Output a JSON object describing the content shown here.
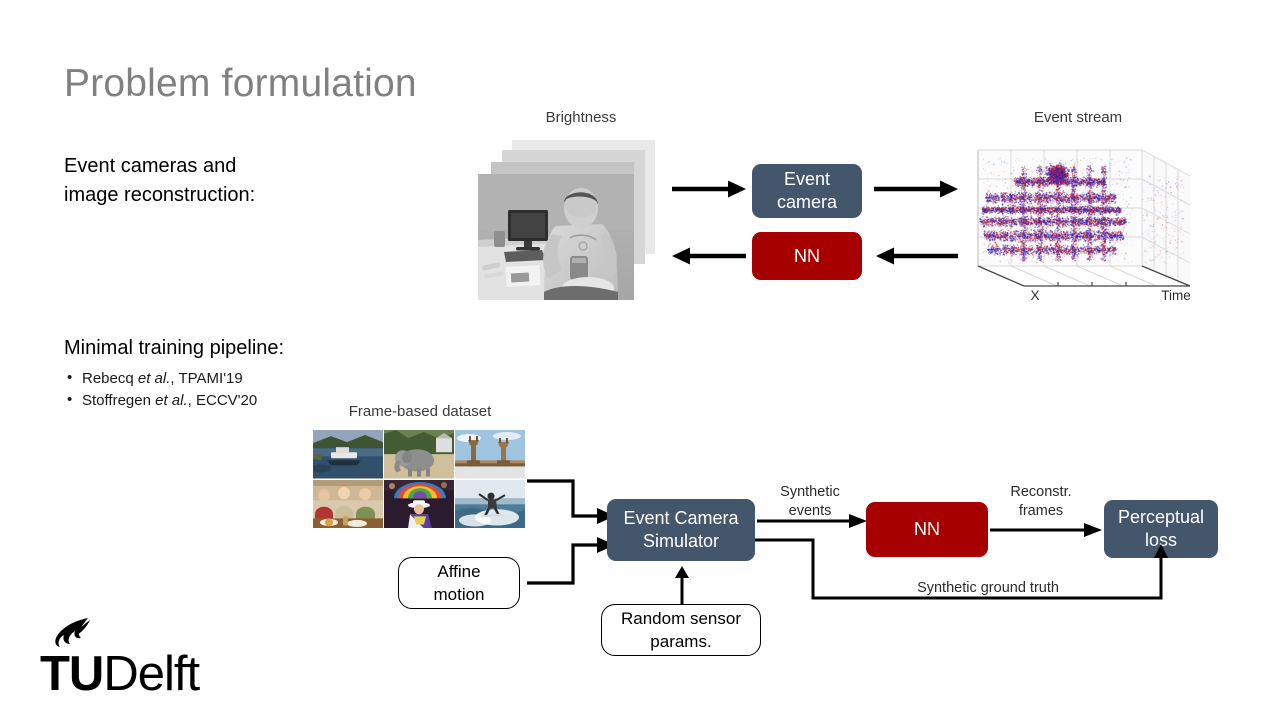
{
  "slide": {
    "title": "Problem formulation",
    "lead_line1": "Event cameras and",
    "lead_line2": "image reconstruction:",
    "section_heading": "Minimal training pipeline:",
    "references": [
      {
        "author": "Rebecq",
        "italic": "et al.",
        "venue": ", TPAMI'19"
      },
      {
        "author": "Stoffregen",
        "italic": "et al.",
        "venue": ", ECCV'20"
      }
    ]
  },
  "top_diagram": {
    "brightness_caption": "Brightness",
    "event_stream_caption": "Event stream",
    "event_camera_label_line1": "Event",
    "event_camera_label_line2": "camera",
    "nn_label": "NN",
    "axis_x": "X",
    "axis_time": "Time"
  },
  "bottom_diagram": {
    "dataset_caption": "Frame-based dataset",
    "affine_line1": "Affine",
    "affine_line2": "motion",
    "simulator_line1": "Event Camera",
    "simulator_line2": "Simulator",
    "random_params_line1": "Random sensor",
    "random_params_line2": "params.",
    "synthetic_events_line1": "Synthetic",
    "synthetic_events_line2": "events",
    "nn_label": "NN",
    "reconstr_line1": "Reconstr.",
    "reconstr_line2": "frames",
    "perceptual_line1": "Perceptual",
    "perceptual_line2": "loss",
    "ground_truth_label": "Synthetic ground truth"
  },
  "logo": {
    "bold_part": "TU",
    "regular_part": "Delft"
  },
  "colors": {
    "title_gray": "#808080",
    "box_blue": "#44566c",
    "box_red": "#a60000",
    "arrow_black": "#000000",
    "event_positive": "#2222cc",
    "event_negative": "#cc2222"
  }
}
